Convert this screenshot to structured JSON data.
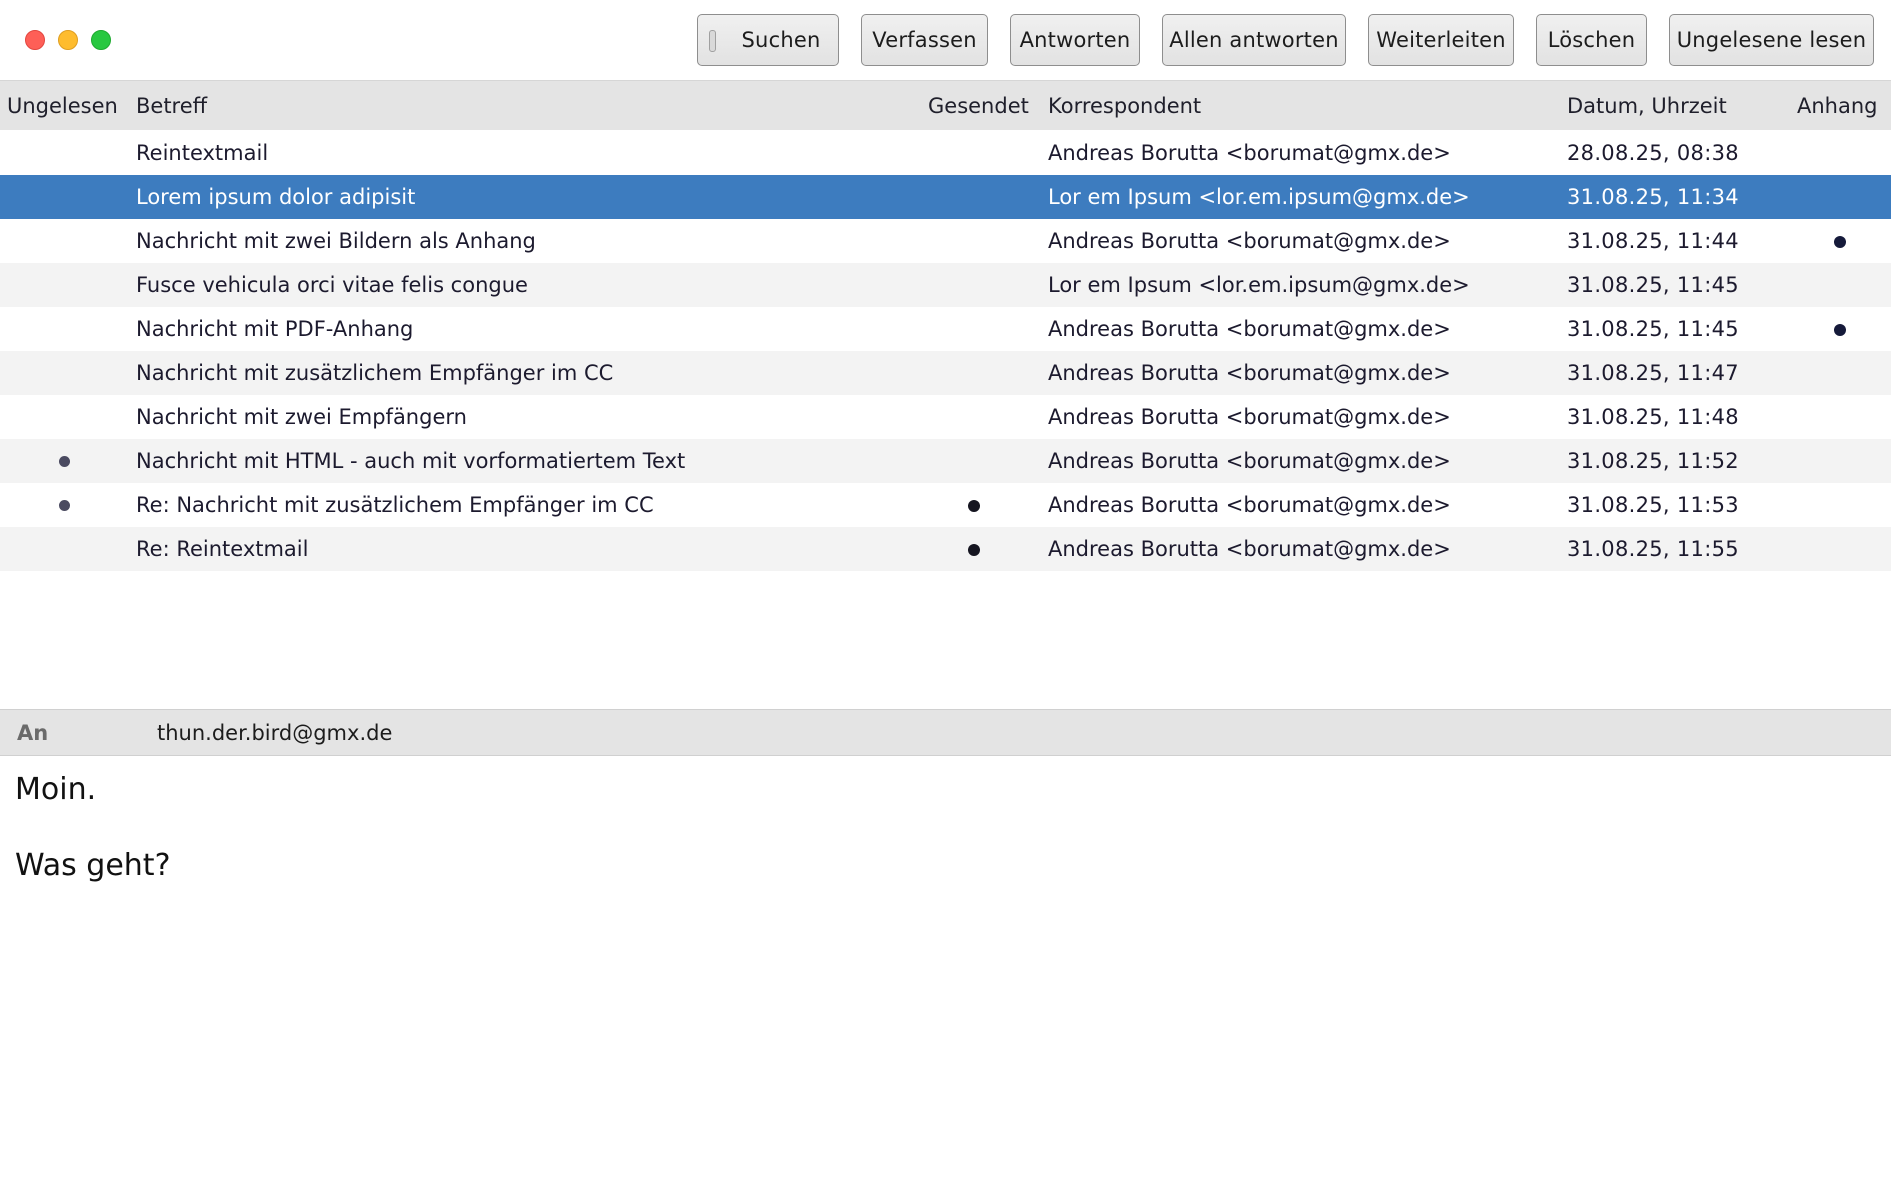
{
  "window": {
    "controls": [
      "close",
      "minimize",
      "maximize"
    ]
  },
  "toolbar": {
    "search_label": "Suchen",
    "compose_label": "Verfassen",
    "reply_label": "Antworten",
    "reply_all_label": "Allen antworten",
    "forward_label": "Weiterleiten",
    "delete_label": "Löschen",
    "read_unread_label": "Ungelesene lesen"
  },
  "table": {
    "headers": {
      "unread": "Ungelesen",
      "subject": "Betreff",
      "sent": "Gesendet",
      "correspondent": "Korrespondent",
      "date": "Datum, Uhrzeit",
      "attachment": "Anhang"
    },
    "selected_index": 1,
    "rows": [
      {
        "subject": "Reintextmail",
        "correspondent": "Andreas Borutta <borumat@gmx.de>",
        "date": "28.08.25, 08:38",
        "unread": false,
        "sent": false,
        "attachment": false
      },
      {
        "subject": "Lorem ipsum dolor adipisit",
        "correspondent": "Lor em Ipsum <lor.em.ipsum@gmx.de>",
        "date": "31.08.25, 11:34",
        "unread": false,
        "sent": false,
        "attachment": false
      },
      {
        "subject": "Nachricht mit zwei Bildern als Anhang",
        "correspondent": "Andreas Borutta <borumat@gmx.de>",
        "date": "31.08.25, 11:44",
        "unread": false,
        "sent": false,
        "attachment": true
      },
      {
        "subject": "Fusce vehicula orci vitae felis congue",
        "correspondent": "Lor em Ipsum <lor.em.ipsum@gmx.de>",
        "date": "31.08.25, 11:45",
        "unread": false,
        "sent": false,
        "attachment": false
      },
      {
        "subject": "Nachricht mit PDF-Anhang",
        "correspondent": "Andreas Borutta <borumat@gmx.de>",
        "date": "31.08.25, 11:45",
        "unread": false,
        "sent": false,
        "attachment": true
      },
      {
        "subject": "Nachricht mit zusätzlichem Empfänger im CC",
        "correspondent": "Andreas Borutta <borumat@gmx.de>",
        "date": "31.08.25, 11:47",
        "unread": false,
        "sent": false,
        "attachment": false
      },
      {
        "subject": "Nachricht mit zwei Empfängern",
        "correspondent": "Andreas Borutta <borumat@gmx.de>",
        "date": "31.08.25, 11:48",
        "unread": false,
        "sent": false,
        "attachment": false
      },
      {
        "subject": "Nachricht mit HTML - auch mit vorformatiertem Text",
        "correspondent": "Andreas Borutta <borumat@gmx.de>",
        "date": "31.08.25, 11:52",
        "unread": true,
        "sent": false,
        "attachment": false
      },
      {
        "subject": "Re: Nachricht mit zusätzlichem Empfänger im CC",
        "correspondent": "Andreas Borutta <borumat@gmx.de>",
        "date": "31.08.25, 11:53",
        "unread": true,
        "sent": true,
        "attachment": false
      },
      {
        "subject": "Re: Reintextmail",
        "correspondent": "Andreas Borutta <borumat@gmx.de>",
        "date": "31.08.25, 11:55",
        "unread": false,
        "sent": true,
        "attachment": false
      }
    ]
  },
  "preview": {
    "to_label": "An",
    "to_value": "thun.der.bird@gmx.de",
    "body_lines": [
      "Moin.",
      "Was geht?"
    ]
  },
  "colors": {
    "selection": "#3d7cbf",
    "header_bg": "#e4e4e4",
    "row_alt": "#f3f3f3"
  }
}
